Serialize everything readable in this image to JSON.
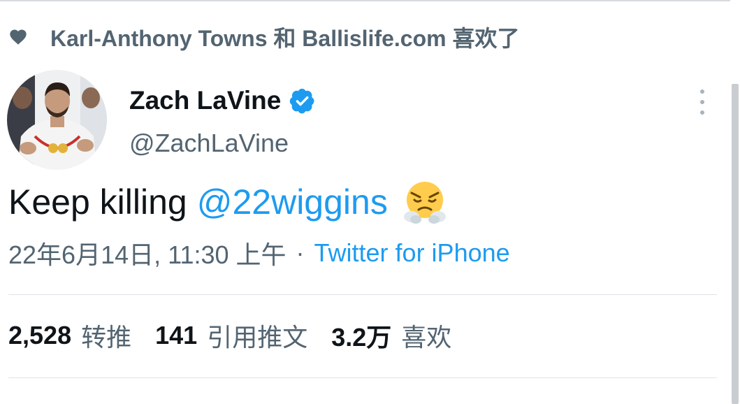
{
  "social_context": {
    "icon": "heart-icon",
    "text": "Karl-Anthony Towns 和 Ballislife.com 喜欢了"
  },
  "author": {
    "display_name": "Zach LaVine",
    "handle": "@ZachLaVine",
    "verified_icon": "verified-badge-icon"
  },
  "tweet": {
    "text": "Keep killing",
    "mention": "@22wiggins",
    "emoji": "face-with-steam-from-nose"
  },
  "meta": {
    "timestamp": "22年6月14日, 11:30 上午",
    "separator": "·",
    "source": "Twitter for iPhone"
  },
  "stats": {
    "retweets": {
      "count": "2,528",
      "label": "转推"
    },
    "quotes": {
      "count": "141",
      "label": "引用推文"
    },
    "likes": {
      "count": "3.2万",
      "label": "喜欢"
    }
  },
  "colors": {
    "link": "#1d9bf0",
    "secondary_text": "#536471",
    "primary_text": "#0f1419"
  }
}
